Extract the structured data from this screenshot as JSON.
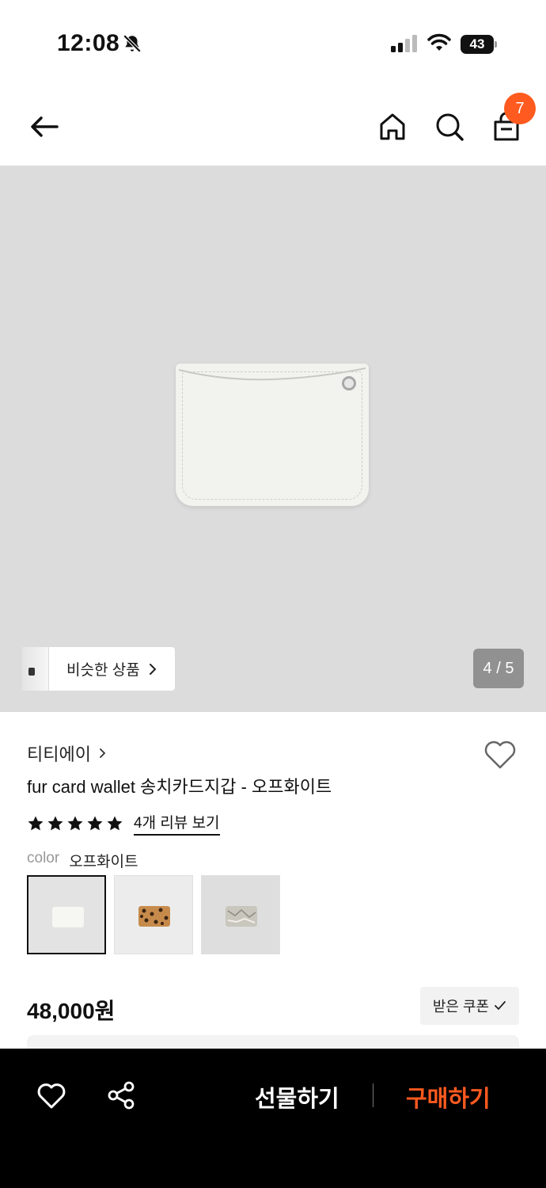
{
  "status_bar": {
    "time": "12:08",
    "battery": "43",
    "icons": [
      "bell-slash-icon",
      "signal-icon",
      "wifi-icon",
      "battery-icon"
    ]
  },
  "nav": {
    "icons": [
      "back-arrow-icon",
      "home-icon",
      "search-icon",
      "shopping-bag-icon"
    ],
    "cart_count": "7",
    "accent_color": "#ff5a1f"
  },
  "gallery": {
    "similar_label": "비슷한 상품",
    "page_counter": "4 / 5"
  },
  "product": {
    "brand": "티티에이",
    "title": "fur card wallet 송치카드지갑 - 오프화이트",
    "rating_stars": 5,
    "review_link": "4개 리뷰 보기",
    "color_label": "color",
    "color_value": "오프화이트",
    "swatches": [
      "오프화이트",
      "레오파드",
      "실버"
    ],
    "price": "48,000원",
    "coupon_label": "받은 쿠폰"
  },
  "bottom_bar": {
    "gift_label": "선물하기",
    "buy_label": "구매하기",
    "buy_color": "#ff5a1f"
  }
}
